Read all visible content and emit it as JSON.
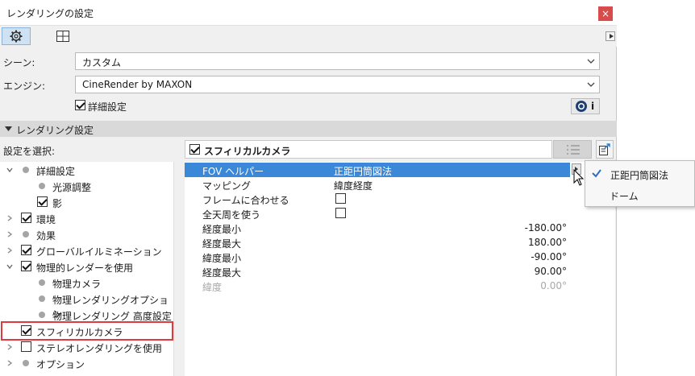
{
  "window": {
    "title": "レンダリングの設定",
    "close": "×"
  },
  "toolbar": {
    "next": "▶"
  },
  "scene": {
    "label": "シーン:",
    "value": "カスタム"
  },
  "engine": {
    "label": "エンジン:",
    "value": "CineRender by MAXON"
  },
  "detail": {
    "label": "詳細設定",
    "checked": true
  },
  "info_button": {
    "label": "i"
  },
  "section": {
    "title": "レンダリング設定"
  },
  "select_label": "設定を選択:",
  "tree": [
    {
      "label": "詳細設定",
      "arrow": "down",
      "mark": "dot",
      "level": 0
    },
    {
      "label": "光源調整",
      "arrow": "none",
      "mark": "dot",
      "level": 1
    },
    {
      "label": "影",
      "arrow": "none",
      "mark": "check",
      "level": 1
    },
    {
      "label": "環境",
      "arrow": "right",
      "mark": "check",
      "level": 0
    },
    {
      "label": "効果",
      "arrow": "right",
      "mark": "dot",
      "level": 0
    },
    {
      "label": "グローバルイルミネーション",
      "arrow": "right",
      "mark": "check",
      "level": 0
    },
    {
      "label": "物理的レンダーを使用",
      "arrow": "down",
      "mark": "check",
      "level": 0
    },
    {
      "label": "物理カメラ",
      "arrow": "none",
      "mark": "dot",
      "level": 1
    },
    {
      "label": "物理レンダリングオプション",
      "arrow": "none",
      "mark": "dot",
      "level": 1
    },
    {
      "label": "物理レンダリング 高度設定",
      "arrow": "none",
      "mark": "dot",
      "level": 1
    },
    {
      "label": "スフィリカルカメラ",
      "arrow": "none",
      "mark": "check",
      "level": 0,
      "highlighted": true
    },
    {
      "label": "ステレオレンダリングを使用",
      "arrow": "right",
      "mark": "box",
      "level": 0
    },
    {
      "label": "オプション",
      "arrow": "right",
      "mark": "dot",
      "level": 0
    }
  ],
  "panel": {
    "title": "スフィリカルカメラ",
    "checked": true
  },
  "properties": [
    {
      "key": "FOV ヘルパー",
      "value": "正距円筒図法",
      "type": "select",
      "selected": true
    },
    {
      "key": "マッピング",
      "value": "緯度経度",
      "type": "text"
    },
    {
      "key": "フレームに合わせる",
      "value": "",
      "type": "checkbox"
    },
    {
      "key": "全天周を使う",
      "value": "",
      "type": "checkbox"
    },
    {
      "key": "経度最小",
      "value": "-180.00°",
      "type": "number"
    },
    {
      "key": "経度最大",
      "value": "180.00°",
      "type": "number"
    },
    {
      "key": "緯度最小",
      "value": "-90.00°",
      "type": "number"
    },
    {
      "key": "経度最大",
      "value": "90.00°",
      "type": "number"
    },
    {
      "key": "緯度",
      "value": "0.00°",
      "type": "number",
      "disabled": true
    }
  ],
  "dropdown": {
    "options": [
      {
        "label": "正距円筒図法",
        "selected": true
      },
      {
        "label": "ドーム",
        "selected": false
      }
    ]
  },
  "colors": {
    "selection": "#3b88d8",
    "highlight_border": "#e0393e",
    "toolbar_active": "#cfe2f4"
  }
}
